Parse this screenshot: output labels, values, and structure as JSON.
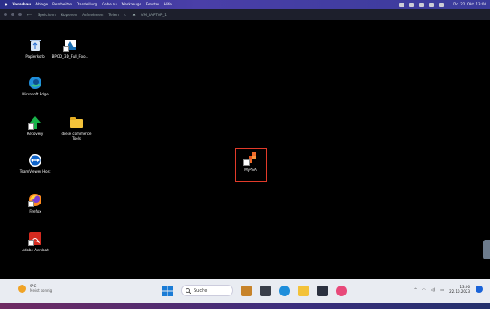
{
  "mac_menubar": {
    "apple": "",
    "items": [
      "Vorschau",
      "Ablage",
      "Bearbeiten",
      "Darstellung",
      "Gehe zu",
      "Werkzeuge",
      "Fenster",
      "Hilfe"
    ],
    "clock": "Do. 22. Okt. 13:00"
  },
  "vm_toolbar": {
    "items": [
      "⟵",
      "Speichern",
      "Kopieren",
      "Aufnehmen",
      "Teilen",
      "☾",
      "✖",
      "VM_LAPTOP_1"
    ]
  },
  "desktop": {
    "icons": [
      {
        "label": "Papierkorb",
        "icon": "recycle-bin-icon"
      },
      {
        "label": "BPOD_3D_Full_Foo...",
        "icon": "mpsa-file-icon"
      },
      {
        "label": "Microsoft Edge",
        "icon": "edge-icon"
      },
      {
        "label": "Recovery",
        "icon": "recovery-icon"
      },
      {
        "label": "diese commerce Tools",
        "icon": "folder-icon"
      },
      {
        "label": "TeamViewer Host",
        "icon": "teamviewer-icon"
      },
      {
        "label": "Firefox",
        "icon": "firefox-icon"
      },
      {
        "label": "Adobe Acrobat",
        "icon": "acrobat-icon"
      },
      {
        "label": "MyPSA",
        "icon": "mypsa-icon"
      }
    ]
  },
  "taskbar": {
    "weather_temp": "9°C",
    "weather_desc": "Meist sonnig",
    "search_placeholder": "Suche",
    "time": "13:00",
    "date": "22.10.2023",
    "colors": {
      "accent": "#1a63d8",
      "selection": "#e23b2a"
    }
  }
}
